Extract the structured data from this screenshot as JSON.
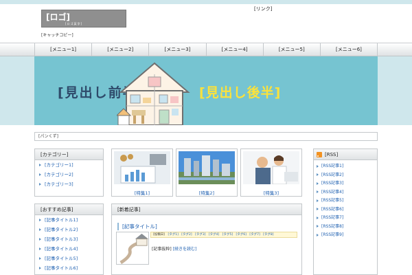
{
  "site": {
    "logo_text": "[ロゴ]",
    "logo_subtext": "[ロゴ英字]",
    "top_link": "[リンク]",
    "tagline": "[キャッチコピー]"
  },
  "nav": [
    "[メニュー1]",
    "[メニュー2]",
    "[メニュー3]",
    "[メニュー4]",
    "[メニュー5]",
    "[メニュー6]"
  ],
  "hero": {
    "left_text": "[見出し前半]",
    "right_text": "[見出し後半]"
  },
  "breadcrumb": "[パンくず]",
  "sidebar_categories": {
    "title": "[カテゴリー]",
    "items": [
      "[カテゴリー1]",
      "[カテゴリー2]",
      "[カテゴリー3]"
    ]
  },
  "sidebar_recommended": {
    "title": "[おすすめ記事]",
    "items": [
      "[記事タイトル1]",
      "[記事タイトル2]",
      "[記事タイトル3]",
      "[記事タイトル4]",
      "[記事タイトル5]",
      "[記事タイトル6]"
    ]
  },
  "features": [
    {
      "caption": "[特集1]"
    },
    {
      "caption": "[特集2]"
    },
    {
      "caption": "[特集3]"
    }
  ],
  "main": {
    "title": "[新着記事]",
    "article": {
      "title": "[記事タイトル]",
      "date": "[投稿日]",
      "tags": [
        "[タグ1]",
        "[タグ2]",
        "[タグ3]",
        "[タグ4]",
        "[タグ5]",
        "[タグ6]",
        "[タグ7]",
        "[タグ8]"
      ],
      "excerpt": "[記事抜粋]",
      "more": "[続きを読む]"
    }
  },
  "rss": {
    "title": "[RSS]",
    "items": [
      "[RSS記事1]",
      "[RSS記事2]",
      "[RSS記事3]",
      "[RSS記事4]",
      "[RSS記事5]",
      "[RSS記事6]",
      "[RSS記事7]",
      "[RSS記事8]",
      "[RSS記事9]"
    ]
  },
  "colors": {
    "link": "#1d5fb0",
    "hero_bg": "#76c4d1",
    "hero_accent": "#fbe23c",
    "hero_dark": "#2e4a6a",
    "band": "#cfe7ec",
    "rss": "#f29222"
  }
}
